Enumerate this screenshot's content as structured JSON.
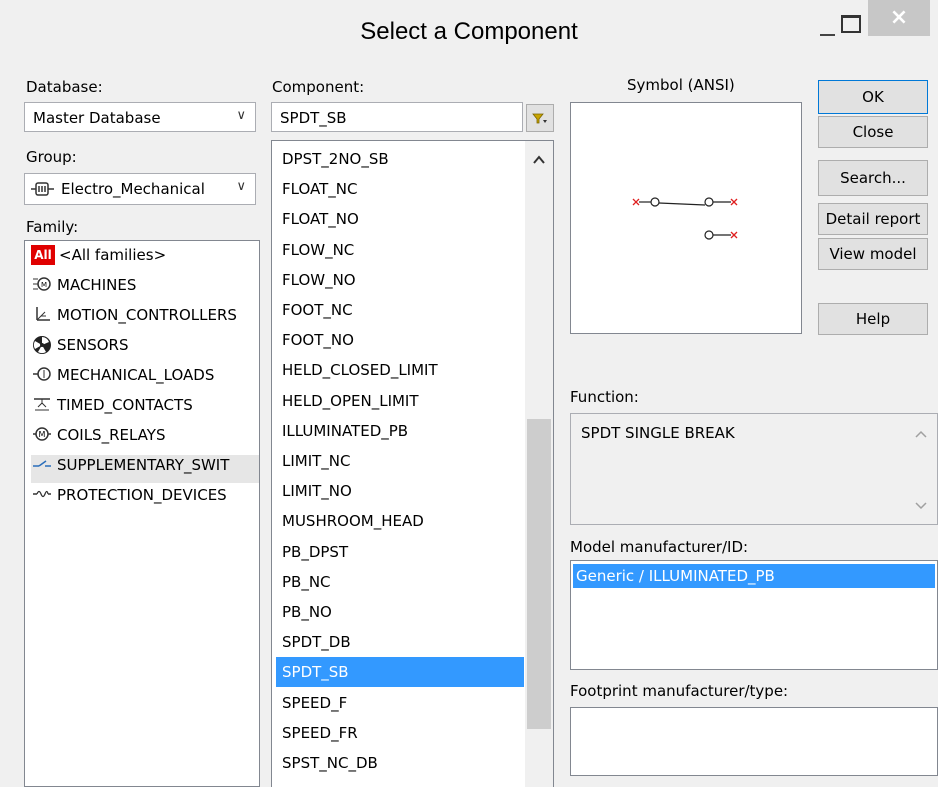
{
  "window": {
    "title": "Select a Component",
    "close_glyph": "×"
  },
  "database": {
    "label": "Database:",
    "value": "Master Database"
  },
  "group": {
    "label": "Group:",
    "value": "Electro_Mechanical",
    "icon": "electro-mechanical-icon"
  },
  "family": {
    "label": "Family:",
    "items": [
      {
        "label": "<All families>",
        "icon": "all-families-icon"
      },
      {
        "label": "MACHINES",
        "icon": "machines-icon"
      },
      {
        "label": "MOTION_CONTROLLERS",
        "icon": "motion-controllers-icon"
      },
      {
        "label": "SENSORS",
        "icon": "sensors-icon"
      },
      {
        "label": "MECHANICAL_LOADS",
        "icon": "mechanical-loads-icon"
      },
      {
        "label": "TIMED_CONTACTS",
        "icon": "timed-contacts-icon"
      },
      {
        "label": "COILS_RELAYS",
        "icon": "coils-relays-icon"
      },
      {
        "label": "SUPPLEMENTARY_SWIT",
        "icon": "supplementary-switches-icon"
      },
      {
        "label": "PROTECTION_DEVICES",
        "icon": "protection-devices-icon"
      }
    ],
    "all_icon_text": "All",
    "selected_index": 7
  },
  "component": {
    "label": "Component:",
    "search_value": "SPDT_SB",
    "items": [
      "DPST_2NO_SB",
      "FLOAT_NC",
      "FLOAT_NO",
      "FLOW_NC",
      "FLOW_NO",
      "FOOT_NC",
      "FOOT_NO",
      "HELD_CLOSED_LIMIT",
      "HELD_OPEN_LIMIT",
      "ILLUMINATED_PB",
      "LIMIT_NC",
      "LIMIT_NO",
      "MUSHROOM_HEAD",
      "PB_DPST",
      "PB_NC",
      "PB_NO",
      "SPDT_DB",
      "SPDT_SB",
      "SPEED_F",
      "SPEED_FR",
      "SPST_NC_DB"
    ],
    "selected_index": 17
  },
  "symbol": {
    "label": "Symbol (ANSI)"
  },
  "function": {
    "label": "Function:",
    "value": "SPDT SINGLE BREAK"
  },
  "model": {
    "label": "Model manufacturer/ID:",
    "items": [
      "Generic / ILLUMINATED_PB"
    ]
  },
  "footprint": {
    "label": "Footprint manufacturer/type:"
  },
  "buttons": {
    "ok": "OK",
    "close": "Close",
    "search": "Search...",
    "detail_report": "Detail report",
    "view_model": "View model",
    "help": "Help"
  },
  "colors": {
    "selection": "#3399ff",
    "symbol_x": "#e02020"
  }
}
